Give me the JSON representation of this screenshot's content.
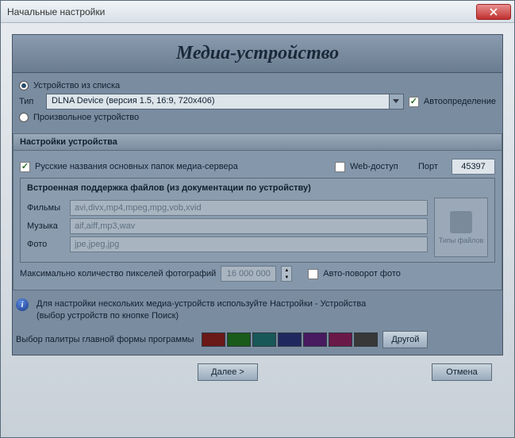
{
  "window": {
    "title": "Начальные настройки"
  },
  "header": {
    "title": "Медиа-устройство"
  },
  "radio_list": {
    "label": "Устройство из списка"
  },
  "type_row": {
    "label": "Тип",
    "value": "DLNA Device (версия 1.5, 16:9, 720x406)",
    "auto": "Автоопределение"
  },
  "radio_custom": {
    "label": "Произвольное устройство"
  },
  "device_settings": {
    "title": "Настройки устройства",
    "russian_folders": "Русские названия основных папок медиа-сервера",
    "web_access": "Web-доступ",
    "port_label": "Порт",
    "port_value": "45397",
    "builtin": {
      "title": "Встроенная поддержка файлов (из документации по устройству)",
      "movies_label": "Фильмы",
      "movies_value": "avi,divx,mp4,mpeg,mpg,vob,xvid",
      "music_label": "Музыка",
      "music_value": "aif,aiff,mp3,wav",
      "photo_label": "Фото",
      "photo_value": "jpe,jpeg,jpg",
      "file_types_btn": "Типы файлов"
    },
    "max_pixels_label": "Максимально количество пикселей фотографий",
    "max_pixels_value": "16 000 000",
    "auto_rotate": "Авто-поворот фото"
  },
  "info": {
    "line1": "Для настройки нескольких медиа-устройств используйте Настройки - Устройства",
    "line2": "(выбор устройств по кнопке Поиск)"
  },
  "palette": {
    "label": "Выбор палитры главной формы программы",
    "other": "Другой",
    "colors": [
      "#6a1818",
      "#1a5a1a",
      "#185858",
      "#202860",
      "#481a60",
      "#6a1848",
      "#383838"
    ]
  },
  "buttons": {
    "next": "Далее >",
    "cancel": "Отмена"
  }
}
